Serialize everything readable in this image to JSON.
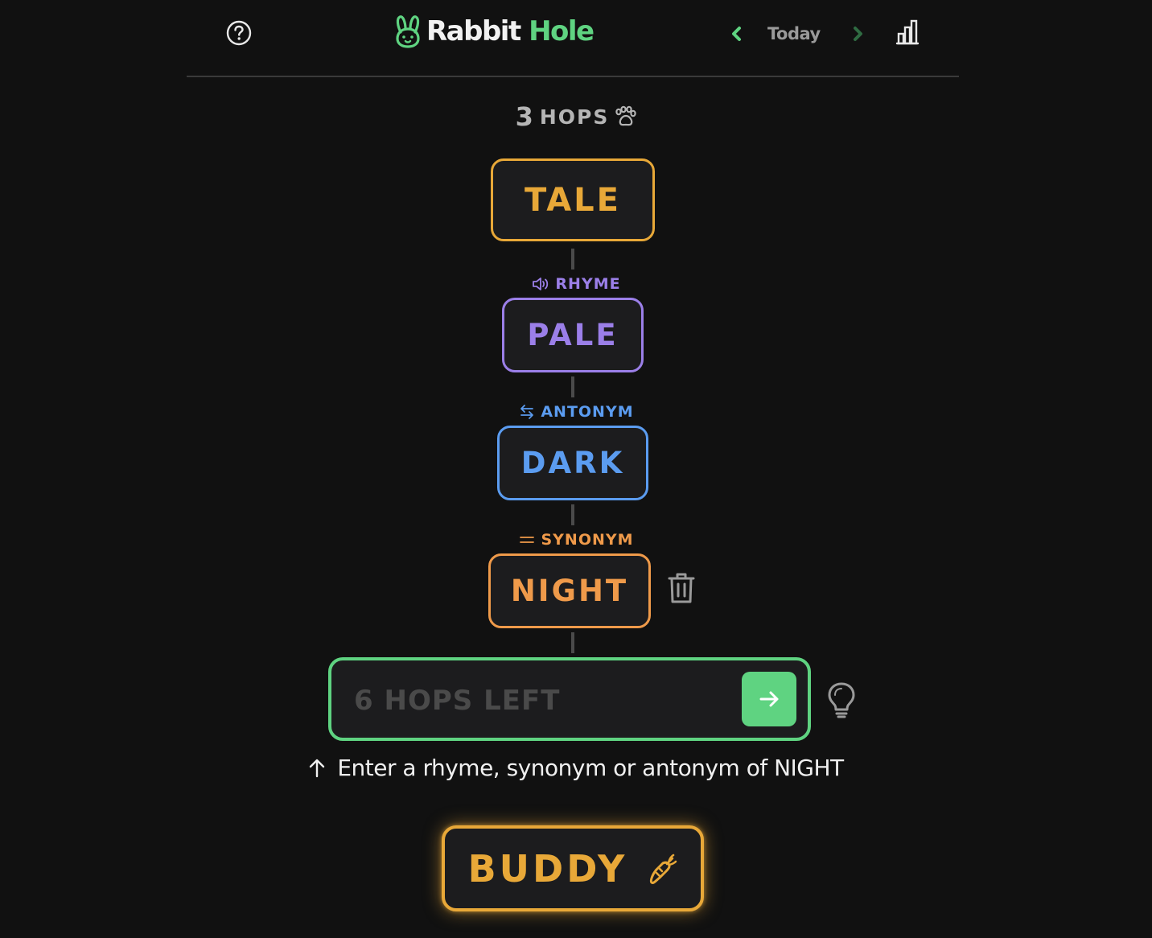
{
  "header": {
    "logo_word1": "Rabbit",
    "logo_word2": "Hole",
    "nav_label": "Today"
  },
  "game": {
    "hops_count": "3",
    "hops_label": "HOPS",
    "chain": [
      {
        "word": "TALE",
        "color": "#e8a838"
      },
      {
        "relation": "RHYME",
        "word": "PALE",
        "color": "#9b7fe8"
      },
      {
        "relation": "ANTONYM",
        "word": "DARK",
        "color": "#5b9cf0"
      },
      {
        "relation": "SYNONYM",
        "word": "NIGHT",
        "color": "#ef9a4a"
      }
    ],
    "input": {
      "value": "",
      "placeholder": "6 HOPS LEFT"
    },
    "instruction": "Enter a rhyme, synonym or antonym of NIGHT",
    "target": {
      "word": "BUDDY",
      "color": "#e8a838"
    }
  },
  "colors": {
    "background": "#111111",
    "accent_green": "#5fd381",
    "box_background": "#1c1c1e"
  },
  "icons": [
    "help-icon",
    "rabbit-icon",
    "chevron-left-icon",
    "chevron-right-icon",
    "bar-chart-icon",
    "paw-icon",
    "speaker-icon",
    "swap-arrows-icon",
    "equals-icon",
    "trash-icon",
    "arrow-right-icon",
    "lightbulb-icon",
    "arrow-up-icon",
    "carrot-icon"
  ]
}
